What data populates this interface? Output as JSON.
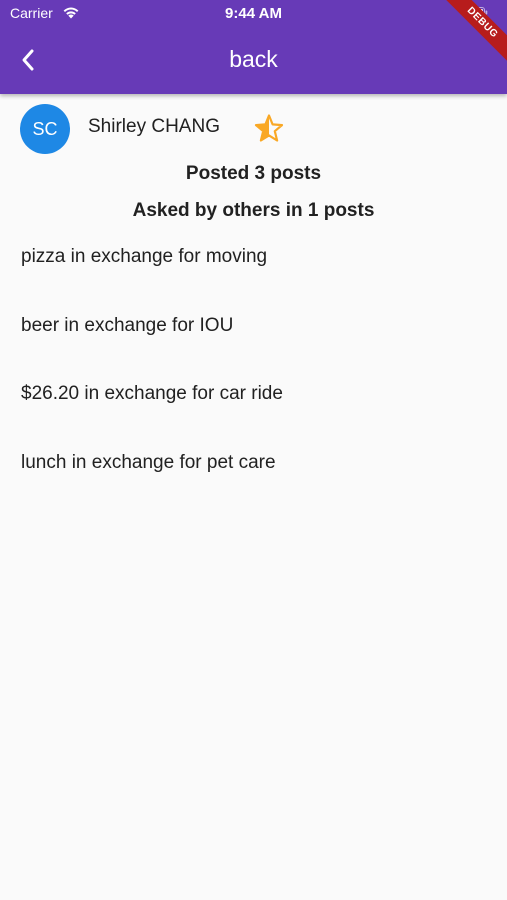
{
  "status_bar": {
    "carrier": "Carrier",
    "time": "9:44 AM"
  },
  "app_bar": {
    "title": "back",
    "debug_banner": "DEBUG",
    "color": "#673ab7"
  },
  "profile": {
    "initials": "SC",
    "name": "Shirley CHANG",
    "avatar_color": "#1e88e5",
    "star_icon": "star-half-icon",
    "star_color": "#f9a825"
  },
  "stats": {
    "posted": "Posted 3 posts",
    "asked": "Asked by others in 1 posts"
  },
  "posts": [
    {
      "text": "pizza in exchange for moving"
    },
    {
      "text": "beer in exchange for IOU"
    },
    {
      "text": "$26.20 in exchange for car ride"
    },
    {
      "text": "lunch in exchange for pet care"
    }
  ]
}
